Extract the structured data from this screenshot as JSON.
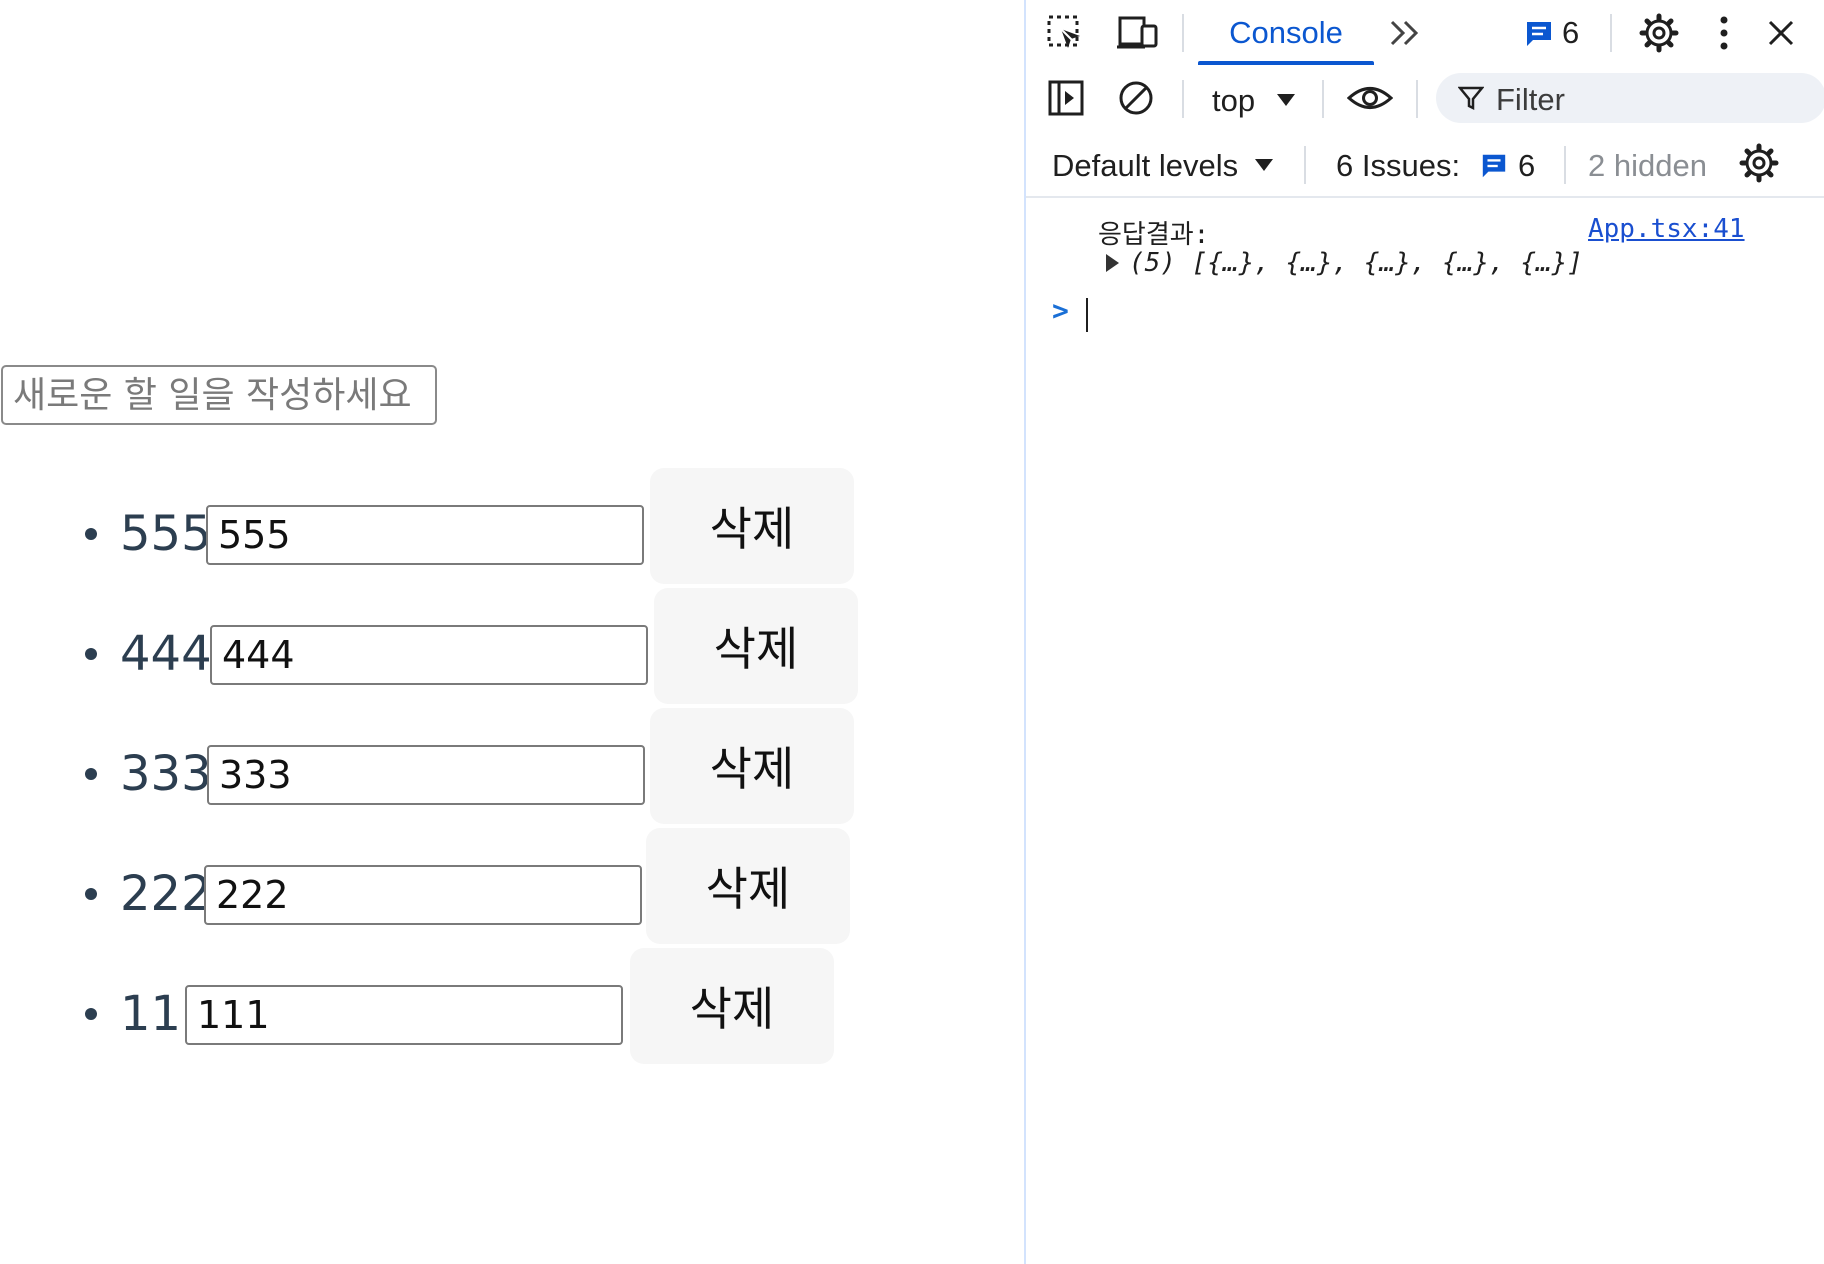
{
  "app": {
    "new_todo_placeholder": "새로운 할 일을 작성하세요",
    "todos": [
      {
        "text": "555",
        "value": "555",
        "delete_label": "삭제"
      },
      {
        "text": "444",
        "value": "444",
        "delete_label": "삭제"
      },
      {
        "text": "333",
        "value": "333",
        "delete_label": "삭제"
      },
      {
        "text": "222",
        "value": "222",
        "delete_label": "삭제"
      },
      {
        "text": "111",
        "value": "111",
        "delete_label": "삭제"
      }
    ]
  },
  "devtools": {
    "tabs": {
      "active": "Console",
      "more": "»",
      "message_count": "6"
    },
    "toolbar": {
      "context": "top",
      "filter_placeholder": "Filter",
      "levels": "Default levels",
      "issues_label": "6 Issues:",
      "issues_count": "6",
      "hidden": "2 hidden"
    },
    "console": {
      "log_label": "응답결과:",
      "log_source": "App.tsx:41",
      "log_array": "(5) [{…}, {…}, {…}, {…}, {…}]",
      "prompt": ">"
    },
    "colors": {
      "accent": "#0b57d0",
      "text": "#1f1f1f",
      "muted": "#8a8e93",
      "link": "#1a4fd0"
    },
    "icons": [
      "inspect-icon",
      "device-toolbar-icon",
      "chevron-double-right-icon",
      "message-icon",
      "settings-icon",
      "more-vert-icon",
      "close-icon",
      "sidebar-icon",
      "clear-console-icon",
      "dropdown-arrow-icon",
      "eye-icon",
      "filter-icon",
      "settings-icon"
    ]
  }
}
